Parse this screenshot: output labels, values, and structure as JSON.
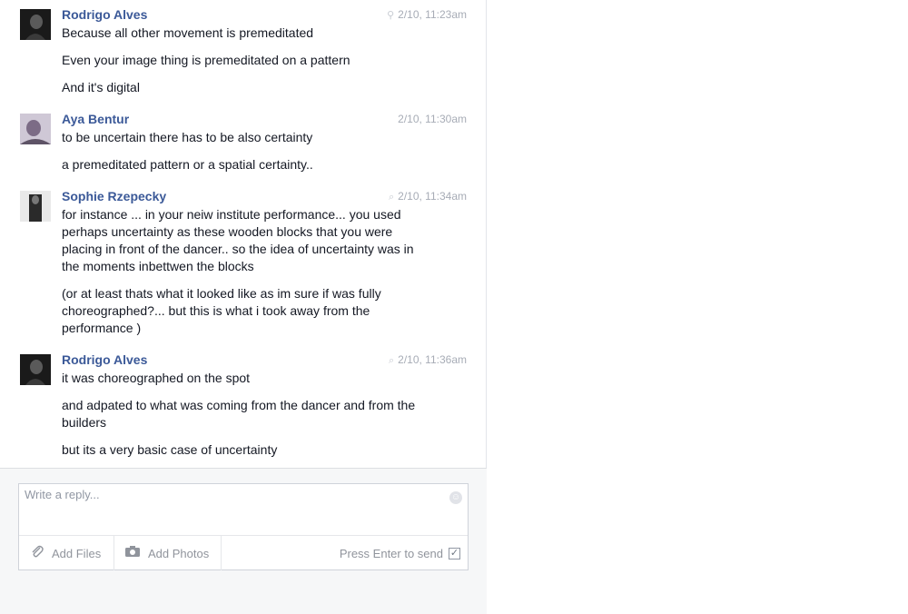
{
  "messages": [
    {
      "sender": "Rodrigo Alves",
      "time": "2/10, 11:23am",
      "status_icon": "location-icon",
      "paragraphs": [
        "Because all other movement is premeditated",
        "Even your image thing is premeditated on a pattern",
        "And it's digital"
      ]
    },
    {
      "sender": "Aya Bentur",
      "time": "2/10, 11:30am",
      "paragraphs": [
        "to be uncertain there has to be also certainty",
        "a premeditated pattern or a spatial certainty.."
      ]
    },
    {
      "sender": "Sophie Rzepecky",
      "time": "2/10, 11:34am",
      "status_icon": "chat-bubble-icon",
      "paragraphs": [
        "for instance ... in your neiw institute performance... you used perhaps uncertainty as these wooden blocks that you were placing in front of the dancer.. so the idea of uncertainty was in the moments inbettwen the blocks",
        "(or at least thats what it looked like as im sure if was fully choreographed?... but this is what i took away from the performance )"
      ]
    },
    {
      "sender": "Rodrigo Alves",
      "time": "2/10, 11:36am",
      "status_icon": "chat-bubble-icon",
      "paragraphs": [
        "it was choreographed on the spot",
        "and adpated to what was coming from the dancer and from the builders",
        "but its a very basic case of uncertainty"
      ]
    }
  ],
  "composer": {
    "placeholder": "Write a reply...",
    "add_files": "Add Files",
    "add_photos": "Add Photos",
    "press_enter": "Press Enter to send",
    "press_enter_checked": true
  }
}
